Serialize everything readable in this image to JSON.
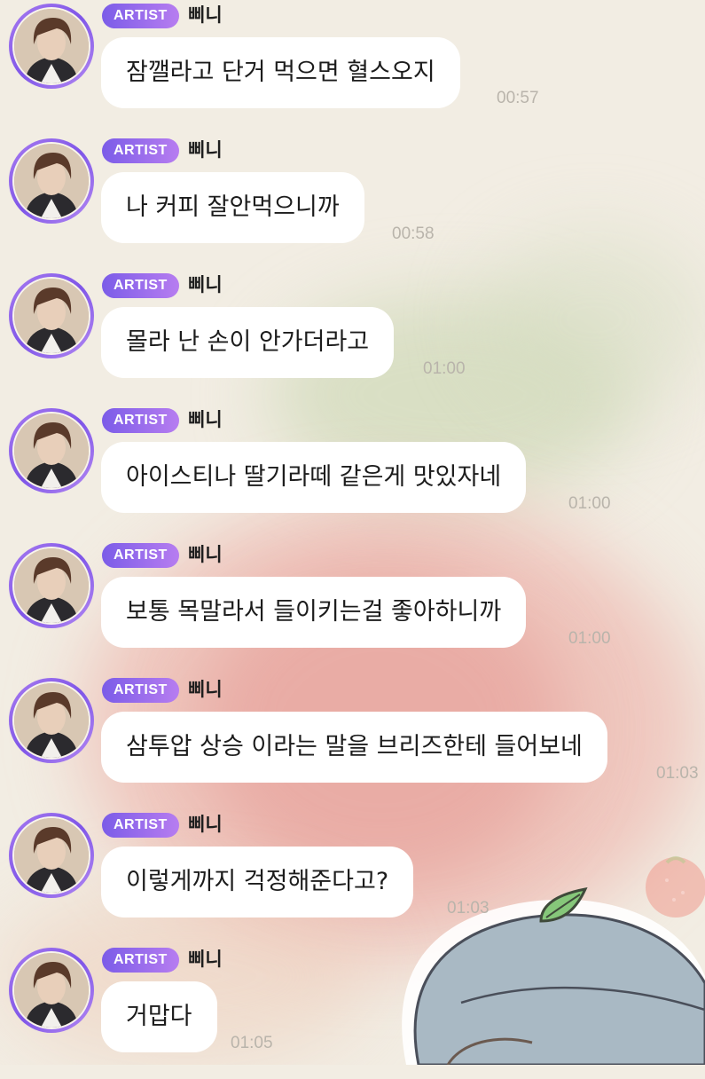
{
  "chat": {
    "badge_label": "ARTIST",
    "sender_name": "삐니",
    "messages": [
      {
        "text": "잠깰라고 단거 먹으면 혈스오지",
        "time": "00:57"
      },
      {
        "text": "나 커피 잘안먹으니까",
        "time": "00:58"
      },
      {
        "text": "몰라 난 손이 안가더라고",
        "time": "01:00"
      },
      {
        "text": "아이스티나 딸기라떼 같은게 맛있자네",
        "time": "01:00"
      },
      {
        "text": "보통 목말라서 들이키는걸 좋아하니까",
        "time": "01:00"
      },
      {
        "text": "삼투압 상승 이라는 말을 브리즈한테 들어보네",
        "time": "01:03"
      },
      {
        "text": "이렇게까지 걱정해준다고?",
        "time": "01:03"
      },
      {
        "text": "거맙다",
        "time": "01:05"
      }
    ]
  },
  "icons": {
    "avatar": "artist-profile-photo",
    "wallpaper_sticker": "beret-character-sticker",
    "wallpaper_fruit": "strawberry-sticker"
  },
  "colors": {
    "badge_gradient_start": "#7b5ce8",
    "badge_gradient_end": "#b77df0",
    "bubble": "#ffffff",
    "timestamp": "#b9b4ab",
    "background": "#f2ede3"
  }
}
